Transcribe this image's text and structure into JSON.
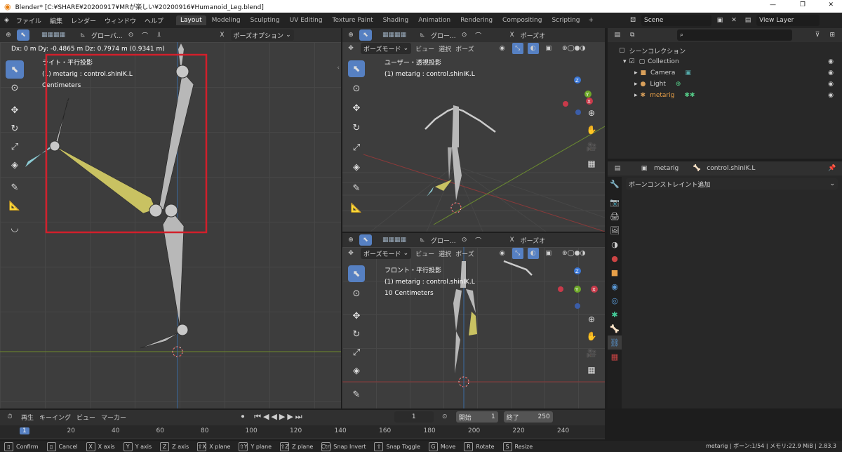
{
  "window": {
    "title": "Blender* [C:¥SHARE¥20200917¥MRが楽しい¥20200916¥Humanoid_Leg.blend]"
  },
  "menu": [
    "ファイル",
    "編集",
    "レンダー",
    "ウィンドウ",
    "ヘルプ"
  ],
  "workspaces": [
    {
      "label": "Layout",
      "active": true
    },
    {
      "label": "Modeling"
    },
    {
      "label": "Sculpting"
    },
    {
      "label": "UV Editing"
    },
    {
      "label": "Texture Paint"
    },
    {
      "label": "Shading"
    },
    {
      "label": "Animation"
    },
    {
      "label": "Rendering"
    },
    {
      "label": "Compositing"
    },
    {
      "label": "Scripting"
    }
  ],
  "scene": {
    "name": "Scene",
    "view_layer": "View Layer"
  },
  "left_view": {
    "transform_axis": "グローバ...",
    "pose_options": "ポーズオプション",
    "info": "Dx: 0 m   Dy: -0.4865 m   Dz: 0.7974 m (0.9341 m)",
    "view_name": "ライト・平行投影",
    "object": "(1) metarig : control.shinIK.L",
    "scale": "Centimeters"
  },
  "tr_view": {
    "transform_axis": "グロー...",
    "pose_options": "ポーズオ",
    "mode": "ポーズモード",
    "menus": [
      "ビュー",
      "選択",
      "ポーズ"
    ],
    "view_name": "ユーザー・透視投影",
    "object": "(1) metarig : control.shinIK.L"
  },
  "br_view": {
    "transform_axis": "グロー...",
    "pose_options": "ポーズオ",
    "mode": "ポーズモード",
    "menus": [
      "ビュー",
      "選択",
      "ポーズ"
    ],
    "view_name": "フロント・平行投影",
    "object": "(1) metarig : control.shinIK.L",
    "scale": "10 Centimeters"
  },
  "outliner": {
    "root": "シーンコレクション",
    "collection": "Collection",
    "items": [
      "Camera",
      "Light",
      "metarig"
    ]
  },
  "properties": {
    "object": "metarig",
    "bone": "control.shinIK.L",
    "add_constraint": "ボーンコンストレイント追加"
  },
  "timeline": {
    "menus": [
      "再生",
      "キーイング",
      "ビュー",
      "マーカー"
    ],
    "current_frame": "1",
    "start_label": "開始",
    "start": "1",
    "end_label": "終了",
    "end": "250",
    "ticks": [
      "1",
      "20",
      "40",
      "60",
      "80",
      "100",
      "120",
      "140",
      "160",
      "180",
      "200",
      "220",
      "240"
    ]
  },
  "status": {
    "items": [
      {
        "key": "",
        "label": "Confirm"
      },
      {
        "key": "",
        "label": "Cancel"
      },
      {
        "key": "X",
        "label": "X axis"
      },
      {
        "key": "Y",
        "label": "Y axis"
      },
      {
        "key": "Z",
        "label": "Z axis"
      },
      {
        "key": "⇧X",
        "label": "X plane"
      },
      {
        "key": "⇧Y",
        "label": "Y plane"
      },
      {
        "key": "⇧Z",
        "label": "Z plane"
      },
      {
        "key": "Ctrl",
        "label": "Snap Invert"
      },
      {
        "key": "⇧",
        "label": "Snap Toggle"
      },
      {
        "key": "G",
        "label": "Move"
      },
      {
        "key": "R",
        "label": "Rotate"
      },
      {
        "key": "S",
        "label": "Resize"
      }
    ],
    "right": "metarig | ボーン:1/54 | メモリ:22.9 MiB | 2.83.3"
  },
  "colors": {
    "accent": "#5680c2",
    "highlight_box": "#d21f2b",
    "selected_bone": "#c9c262"
  }
}
